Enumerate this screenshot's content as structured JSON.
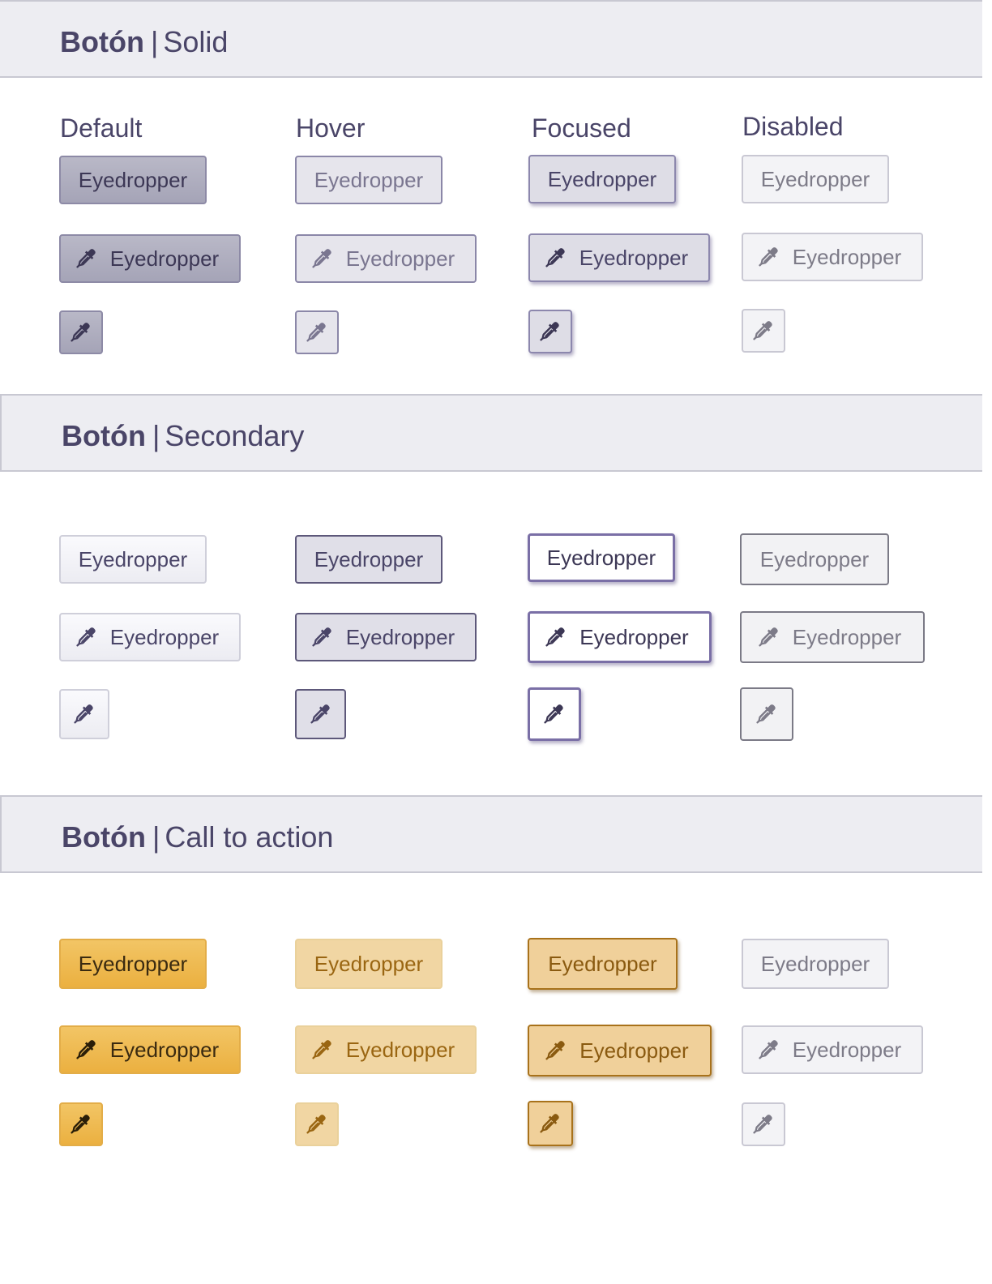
{
  "sections": [
    {
      "strong": "Botón",
      "separator": "|",
      "variant": "Solid"
    },
    {
      "strong": "Botón",
      "separator": "|",
      "variant": "Secondary"
    },
    {
      "strong": "Botón",
      "separator": "|",
      "variant": "Call to action"
    }
  ],
  "states": [
    "Default",
    "Hover",
    "Focused",
    "Disabled"
  ],
  "button_label": "Eyedropper",
  "icon": "eyedropper-icon",
  "colors": {
    "band_background": "#ededf2",
    "text_primary": "#4a4568",
    "cta_accent": "#ebb040",
    "focus_ring": "#7a6fa6"
  }
}
